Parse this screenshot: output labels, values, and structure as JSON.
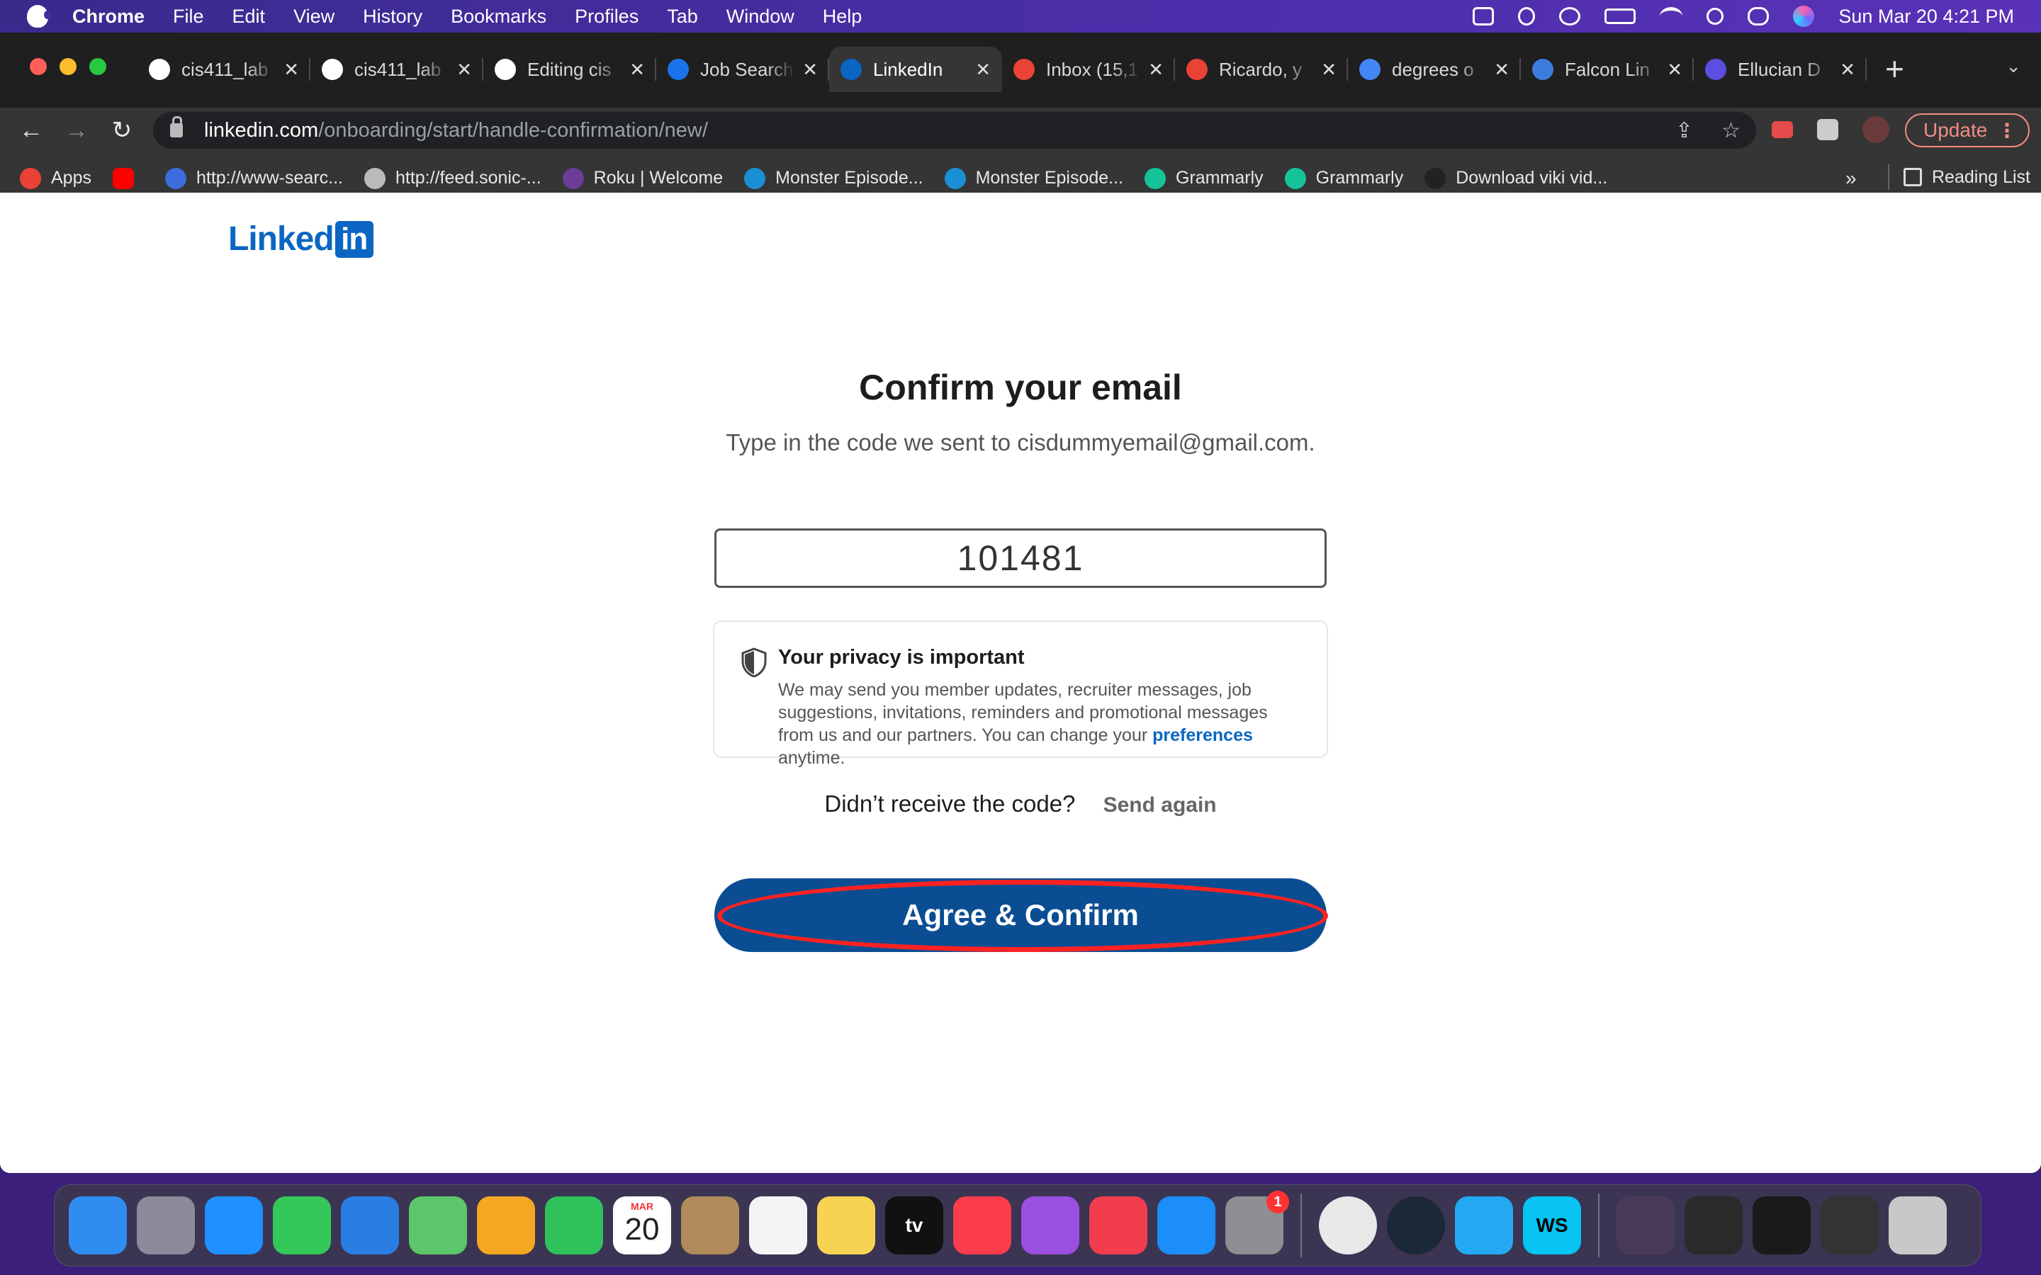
{
  "menubar": {
    "app": "Chrome",
    "items": [
      "File",
      "Edit",
      "View",
      "History",
      "Bookmarks",
      "Profiles",
      "Tab",
      "Window",
      "Help"
    ],
    "clock": "Sun Mar 20  4:21 PM"
  },
  "tabs": [
    {
      "title": "cis411_lab",
      "icon": "github-icon",
      "color": "#ffffff"
    },
    {
      "title": "cis411_lab",
      "icon": "github-icon",
      "color": "#ffffff"
    },
    {
      "title": "Editing cis",
      "icon": "github-icon",
      "color": "#ffffff"
    },
    {
      "title": "Job Search",
      "icon": "info-icon",
      "color": "#1a73e8"
    },
    {
      "title": "LinkedIn",
      "icon": "linkedin-icon",
      "color": "#0a66c2"
    },
    {
      "title": "Inbox (15,1",
      "icon": "gmail-icon",
      "color": "#ea4335"
    },
    {
      "title": "Ricardo, y",
      "icon": "gmail-icon",
      "color": "#ea4335"
    },
    {
      "title": "degrees o",
      "icon": "google-icon",
      "color": "#4285f4"
    },
    {
      "title": "Falcon Lin",
      "icon": "falcon-icon",
      "color": "#3b7ddd"
    },
    {
      "title": "Ellucian D",
      "icon": "ellucian-icon",
      "color": "#5b4ee0"
    }
  ],
  "omnibox": {
    "host": "linkedin.com",
    "path": "/onboarding/start/handle-confirmation/new/"
  },
  "update_label": "Update",
  "bookmarks": [
    {
      "label": "Apps",
      "icon": "apps-grid-icon",
      "color": "#e94235"
    },
    {
      "label": "",
      "icon": "youtube-icon",
      "color": "#ff0000"
    },
    {
      "label": "http://www-searc...",
      "icon": "search-globe-icon",
      "color": "#3b6ddc"
    },
    {
      "label": "http://feed.sonic-...",
      "icon": "magnifier-icon",
      "color": "#bbbbbb"
    },
    {
      "label": "Roku | Welcome",
      "icon": "roku-icon",
      "color": "#6c3c97"
    },
    {
      "label": "Monster Episode...",
      "icon": "att-icon",
      "color": "#1b8fd6"
    },
    {
      "label": "Monster Episode...",
      "icon": "att-icon",
      "color": "#1b8fd6"
    },
    {
      "label": "Grammarly",
      "icon": "grammarly-icon",
      "color": "#15c39a"
    },
    {
      "label": "Grammarly",
      "icon": "grammarly-icon",
      "color": "#15c39a"
    },
    {
      "label": "Download viki vid...",
      "icon": "cloud-icon",
      "color": "#222222"
    }
  ],
  "reading_list": "Reading List",
  "page": {
    "logo_text": "Linked",
    "logo_in": "in",
    "heading": "Confirm your email",
    "subtext": "Type in the code we sent to cisdummyemail@gmail.com.",
    "code_value": "101481",
    "privacy_title": "Your privacy is important",
    "privacy_body": "We may send you member updates, recruiter messages, job suggestions, invitations, reminders and promotional messages from us and our partners. You can change your",
    "privacy_link": "preferences",
    "privacy_tail": "anytime.",
    "resend_prompt": "Didn’t receive the code?",
    "resend_link": "Send again",
    "confirm_label": "Agree & Confirm"
  },
  "dock": [
    {
      "name": "finder-icon",
      "color": "#2f8cf0"
    },
    {
      "name": "launchpad-icon",
      "color": "#8a8a9a"
    },
    {
      "name": "safari-icon",
      "color": "#1e90ff"
    },
    {
      "name": "messages-icon",
      "color": "#34c759"
    },
    {
      "name": "mail-icon",
      "color": "#2a7de1"
    },
    {
      "name": "maps-icon",
      "color": "#5cc66b"
    },
    {
      "name": "photos-icon",
      "color": "#f5a623"
    },
    {
      "name": "facetime-icon",
      "color": "#2fc25b"
    },
    {
      "name": "calendar-icon",
      "color": "#ffffff",
      "month": "MAR",
      "day": "20"
    },
    {
      "name": "contacts-icon",
      "color": "#b08a5a"
    },
    {
      "name": "reminders-icon",
      "color": "#f4f4f4"
    },
    {
      "name": "notes-icon",
      "color": "#f7d354"
    },
    {
      "name": "apple-tv-icon",
      "color": "#111111",
      "label": "tv"
    },
    {
      "name": "music-icon",
      "color": "#fa3c4c"
    },
    {
      "name": "podcasts-icon",
      "color": "#9b4fe0"
    },
    {
      "name": "news-icon",
      "color": "#f23d4f"
    },
    {
      "name": "app-store-icon",
      "color": "#1c8ef9"
    },
    {
      "name": "system-preferences-icon",
      "color": "#8e8e93",
      "badge": "1"
    },
    {
      "sep": true
    },
    {
      "name": "chrome-icon",
      "color": "#e8e8e8"
    },
    {
      "name": "steam-icon",
      "color": "#1b2838"
    },
    {
      "name": "vscode-icon",
      "color": "#23a9f2"
    },
    {
      "name": "webstorm-icon",
      "color": "#07c3f2",
      "label": "WS"
    },
    {
      "sep": true
    },
    {
      "name": "recent-photo-thumbnail",
      "color": "#4a3a5a"
    },
    {
      "name": "minimized-window-1",
      "color": "#2a2a2a"
    },
    {
      "name": "minimized-window-2",
      "color": "#1a1a1a"
    },
    {
      "name": "minimized-window-3",
      "color": "#333333"
    },
    {
      "name": "trash-icon",
      "color": "#c8c8c8"
    }
  ]
}
